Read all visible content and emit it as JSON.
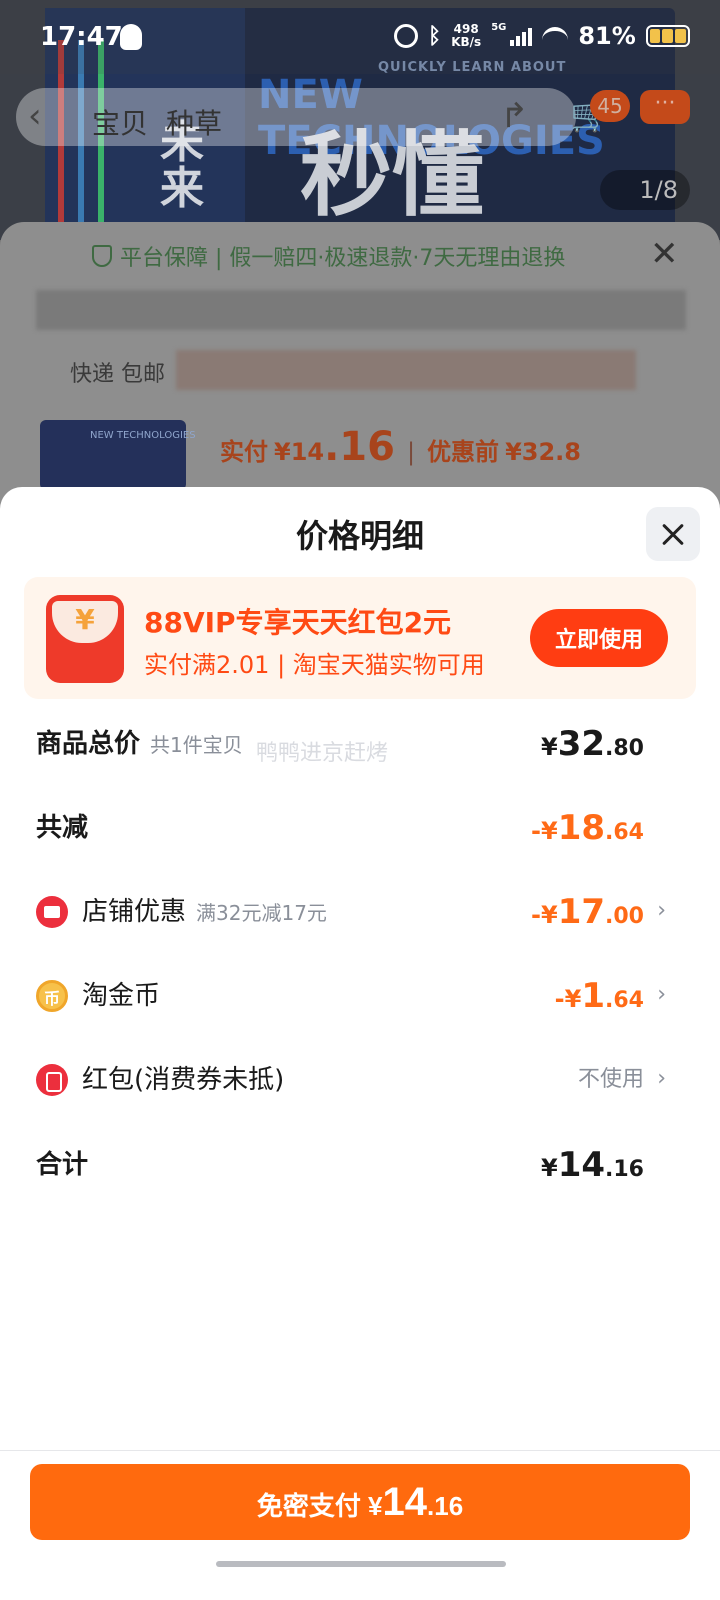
{
  "status_bar": {
    "time": "17:47",
    "network_speed_value": "498",
    "network_speed_unit": "KB/s",
    "network_type": "5G",
    "battery": "81%"
  },
  "background": {
    "nav_tab_1": "宝贝",
    "nav_tab_2": "种草",
    "cart_count": "45",
    "image_counter": "1/8",
    "hero_en_small": "QUICKLY LEARN ABOUT",
    "hero_en_big": "NEW TECHNOLOGIES",
    "hero_cn": "秒懂",
    "hero_side": "未来",
    "guarantee_text": "平台保障 | 假一赔四·极速退款·7天无理由退换",
    "shipping_text": "快递 包邮",
    "order_price_label": "实付",
    "order_price_int": "¥14",
    "order_price_dec": ".16",
    "order_before_label": "优惠前",
    "order_before_value": "¥32.8"
  },
  "sheet": {
    "title": "价格明细",
    "vip_banner": {
      "yen_symbol": "¥",
      "title": "88VIP专享天天红包2元",
      "subtitle": "实付满2.01 | 淘宝天猫实物可用",
      "button_label": "立即使用"
    },
    "watermark": "鸭鸭进京赶烤",
    "rows": {
      "total": {
        "label": "商品总价",
        "hint": "共1件宝贝",
        "currency": "¥",
        "int": "32",
        "dec": ".80"
      },
      "reduce": {
        "label": "共减",
        "currency": "-¥",
        "int": "18",
        "dec": ".64"
      },
      "shop": {
        "label": "店铺优惠",
        "hint": "满32元减17元",
        "currency": "-¥",
        "int": "17",
        "dec": ".00"
      },
      "coin": {
        "label": "淘金币",
        "icon_glyph": "币",
        "currency": "-¥",
        "int": "1",
        "dec": ".64"
      },
      "redpack": {
        "label": "红包(消费券未抵)",
        "value": "不使用"
      },
      "sum": {
        "label": "合计",
        "currency": "¥",
        "int": "14",
        "dec": ".16"
      }
    },
    "pay_button": {
      "label": "免密支付 ¥",
      "int": "14",
      "dec": ".16"
    }
  },
  "icons": {
    "arrow": "chevron-right-icon",
    "close": "close-icon",
    "shop": "shop-icon",
    "coin": "coin-icon",
    "redpack": "red-packet-icon"
  },
  "colors": {
    "accent_orange": "#ff6a0e",
    "discount_orange": "#ff6a16",
    "vip_red": "#ff4a14"
  }
}
